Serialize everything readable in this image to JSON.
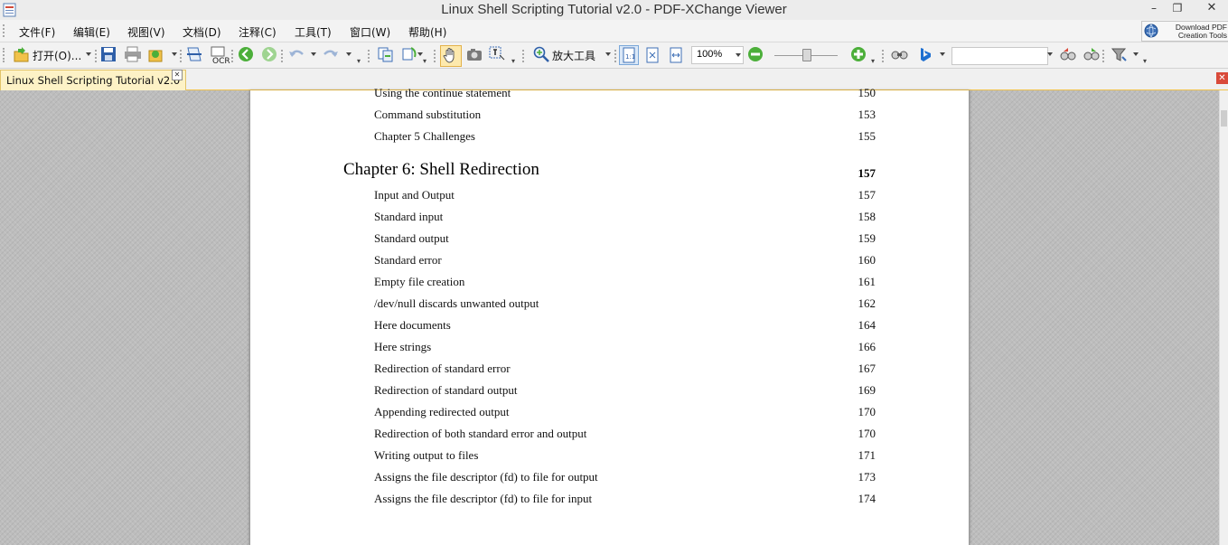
{
  "window": {
    "title": "Linux Shell Scripting Tutorial v2.0 - PDF-XChange Viewer",
    "minimize_glyph": "–",
    "maximize_glyph": "❐",
    "close_glyph": "✕"
  },
  "menu": {
    "items": [
      "文件(F)",
      "编辑(E)",
      "视图(V)",
      "文档(D)",
      "注释(C)",
      "工具(T)",
      "窗口(W)",
      "帮助(H)"
    ],
    "download_tools": "Download PDF Creation Tools",
    "download_line1": "Download PDF",
    "download_line2": "Creation Tools"
  },
  "toolbar": {
    "open_label": "打开(O)...",
    "ocr_label": "OCR",
    "zoom_tool_label": "放大工具",
    "zoom_value": "100%",
    "search_value": ""
  },
  "tabs": [
    {
      "label": "Linux Shell Scripting Tutorial v2.0",
      "active": true
    }
  ],
  "document": {
    "entries_before": [
      {
        "title": "Using the continue statement",
        "page": "150"
      },
      {
        "title": "Command substitution",
        "page": "153"
      },
      {
        "title": "Chapter 5 Challenges",
        "page": "155"
      }
    ],
    "chapter": {
      "title": "Chapter 6: Shell Redirection",
      "page": "157"
    },
    "entries": [
      {
        "title": "Input and Output",
        "page": "157"
      },
      {
        "title": "Standard input",
        "page": "158"
      },
      {
        "title": "Standard output",
        "page": "159"
      },
      {
        "title": "Standard error",
        "page": "160"
      },
      {
        "title": "Empty file creation",
        "page": "161"
      },
      {
        "title": "/dev/null discards unwanted output",
        "page": "162"
      },
      {
        "title": "Here documents",
        "page": "164"
      },
      {
        "title": "Here strings",
        "page": "166"
      },
      {
        "title": "Redirection of standard error",
        "page": "167"
      },
      {
        "title": "Redirection of standard output",
        "page": "169"
      },
      {
        "title": "Appending redirected output",
        "page": "170"
      },
      {
        "title": "Redirection of both standard error and output",
        "page": "170"
      },
      {
        "title": "Writing output to files",
        "page": "171"
      },
      {
        "title": "Assigns the file descriptor (fd) to file for output",
        "page": "173"
      },
      {
        "title": "Assigns the file descriptor (fd) to file for input",
        "page": "174"
      }
    ]
  },
  "colors": {
    "tab_accent": "#f1c24a",
    "close_red": "#d94a3a",
    "nav_green": "#4caf3a"
  }
}
